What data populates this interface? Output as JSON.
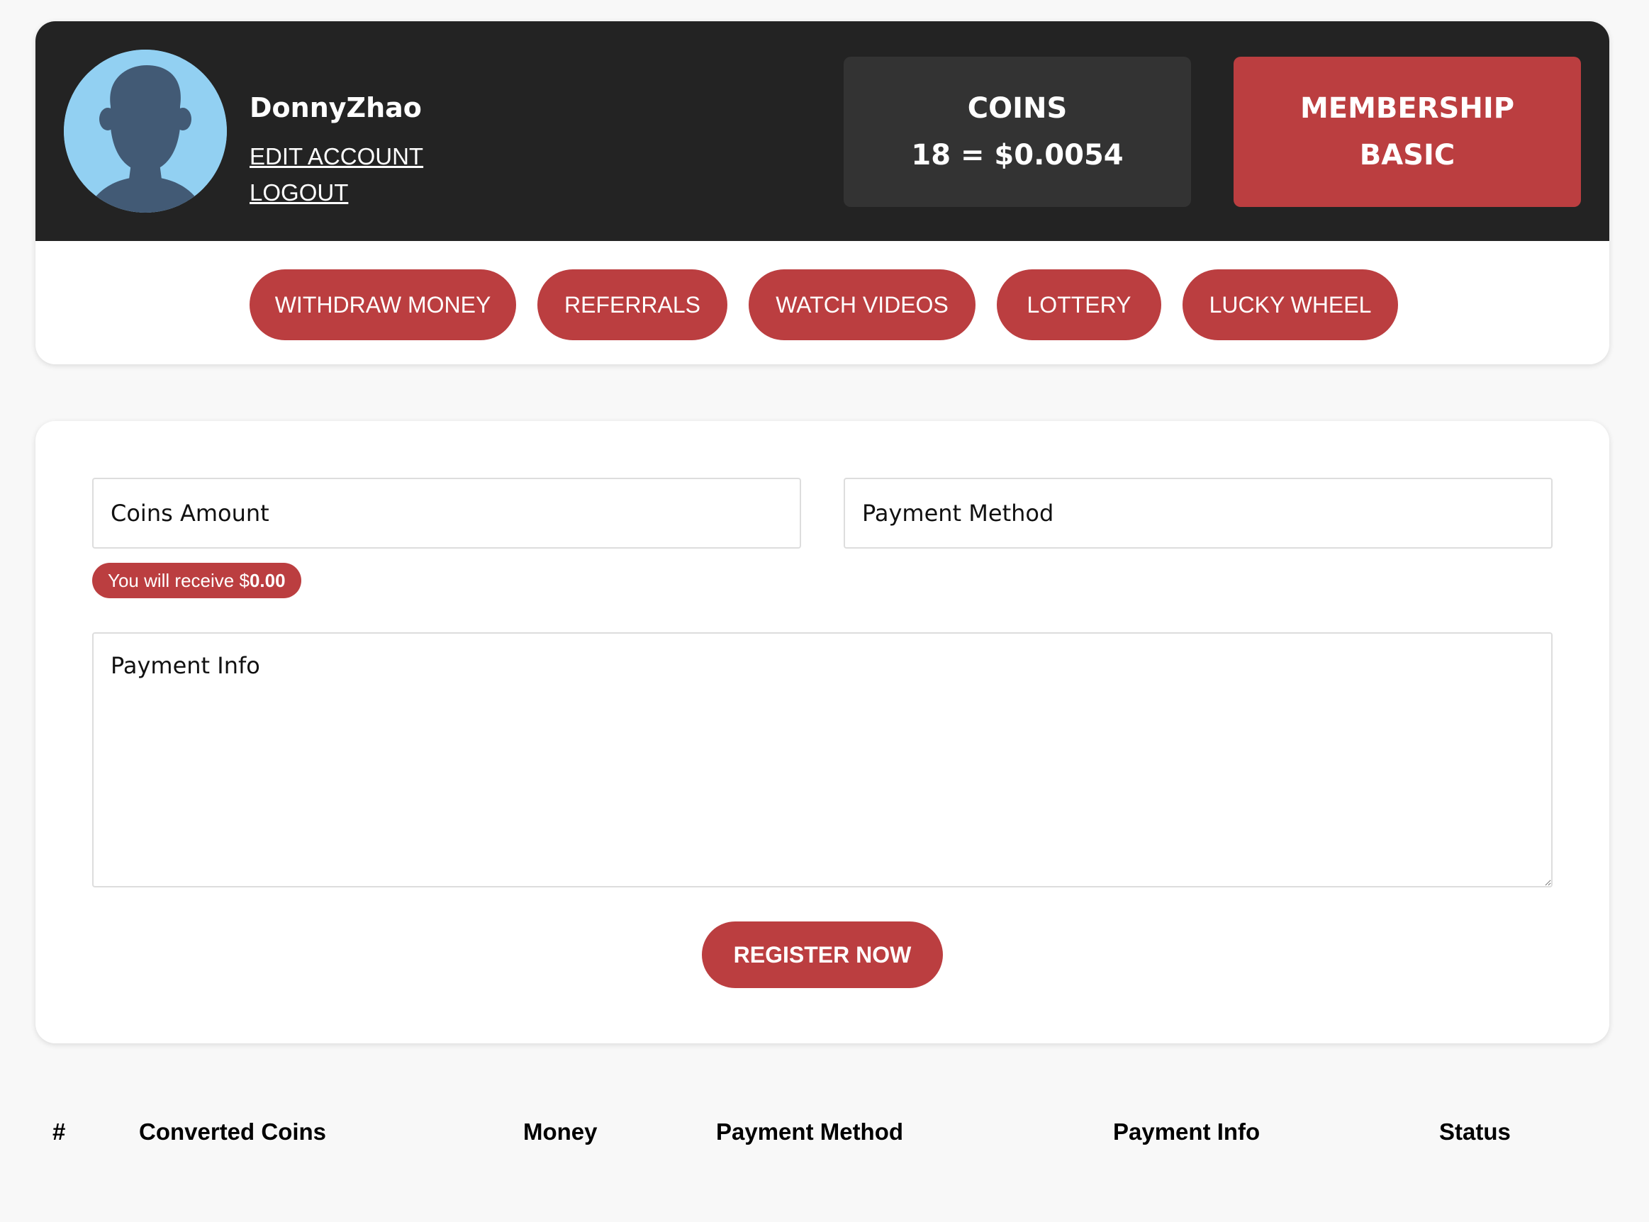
{
  "profile": {
    "username": "DonnyZhao",
    "edit_account_label": "EDIT ACCOUNT",
    "logout_label": "LOGOUT",
    "avatar_icon": "user-silhouette-icon"
  },
  "coins": {
    "label": "COINS",
    "value_text": "18 = $0.0054"
  },
  "membership": {
    "label": "MEMBERSHIP",
    "level": "BASIC"
  },
  "nav": {
    "items": [
      {
        "label": "WITHDRAW MONEY"
      },
      {
        "label": "REFERRALS"
      },
      {
        "label": "WATCH VIDEOS"
      },
      {
        "label": "LOTTERY"
      },
      {
        "label": "LUCKY WHEEL"
      }
    ]
  },
  "form": {
    "coins_amount_placeholder": "Coins Amount",
    "payment_method_placeholder": "Payment Method",
    "payment_info_placeholder": "Payment Info",
    "receive_prefix": "You will receive $",
    "receive_amount": "0.00",
    "submit_label": "REGISTER NOW"
  },
  "table": {
    "columns": [
      "#",
      "Converted Coins",
      "Money",
      "Payment Method",
      "Payment Info",
      "Status"
    ],
    "rows": []
  },
  "colors": {
    "accent": "#bb3e40",
    "header_bg": "#232323",
    "coins_box_bg": "#333333",
    "page_bg": "#f8f8f8",
    "avatar_bg": "#92d0f2",
    "avatar_figure": "#425a75"
  }
}
